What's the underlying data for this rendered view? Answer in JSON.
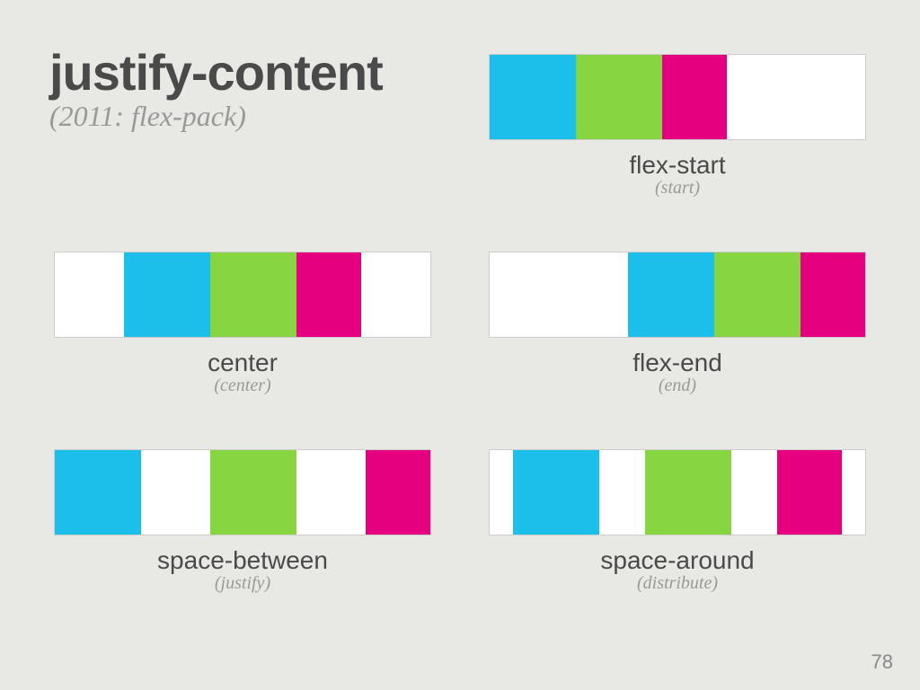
{
  "header": {
    "title": "justify-content",
    "subtitle": "(2011: flex-pack)"
  },
  "examples": {
    "start": {
      "label": "flex-start",
      "alt": "(start)"
    },
    "center": {
      "label": "center",
      "alt": "(center)"
    },
    "end": {
      "label": "flex-end",
      "alt": "(end)"
    },
    "between": {
      "label": "space-between",
      "alt": "(justify)"
    },
    "around": {
      "label": "space-around",
      "alt": "(distribute)"
    }
  },
  "colors": {
    "blue": "#1cbfe9",
    "green": "#87d540",
    "magenta": "#e4007f"
  },
  "pageNumber": "78"
}
